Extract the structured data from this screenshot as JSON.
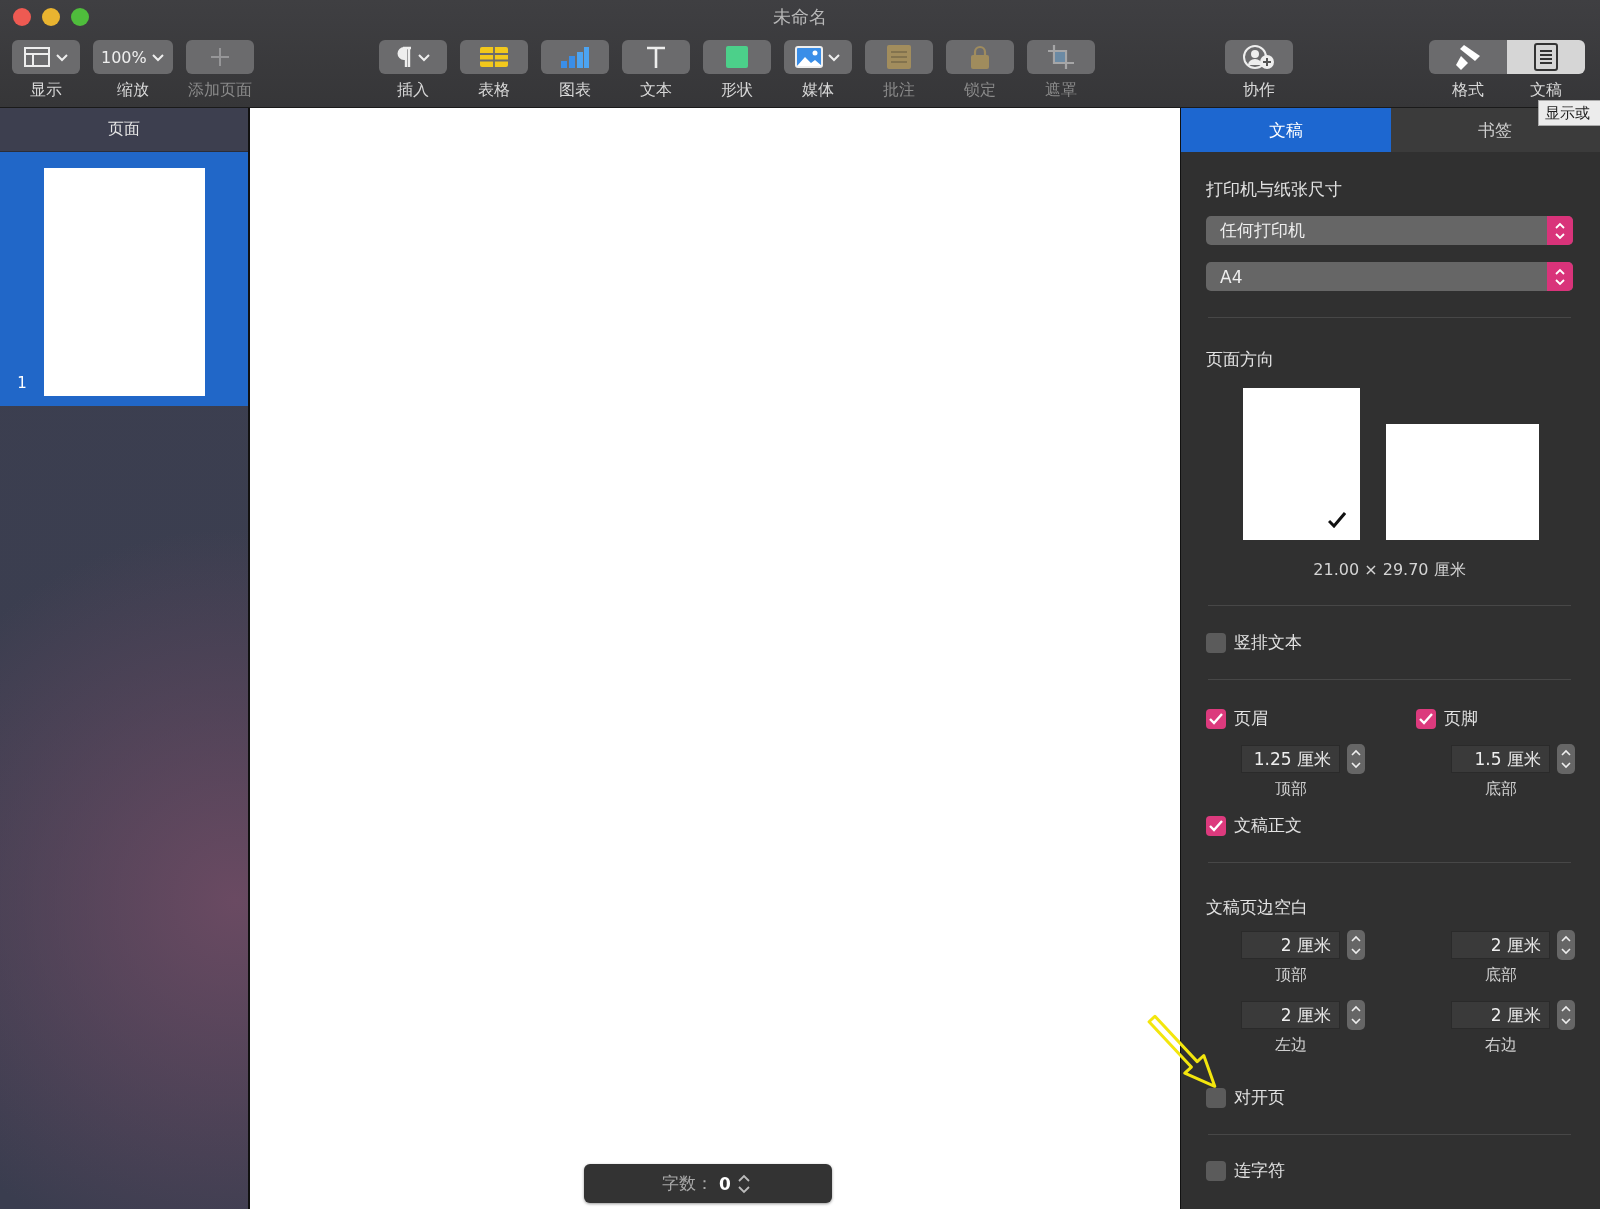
{
  "window": {
    "title": "未命名"
  },
  "toolbar": {
    "groups": [
      [
        {
          "kind": "view",
          "label": "显示",
          "disabled": false
        },
        {
          "kind": "zoom",
          "label": "缩放",
          "value": "100%",
          "disabled": false
        },
        {
          "kind": "add_page",
          "label": "添加页面",
          "disabled": true
        }
      ],
      [
        {
          "kind": "insert",
          "label": "插入",
          "disabled": false
        },
        {
          "kind": "table",
          "label": "表格",
          "disabled": false
        },
        {
          "kind": "chart",
          "label": "图表",
          "disabled": false
        },
        {
          "kind": "text",
          "label": "文本",
          "disabled": false
        },
        {
          "kind": "shape",
          "label": "形状",
          "disabled": false
        },
        {
          "kind": "media",
          "label": "媒体",
          "disabled": false
        },
        {
          "kind": "comment",
          "label": "批注",
          "disabled": true
        },
        {
          "kind": "lock",
          "label": "锁定",
          "disabled": true
        },
        {
          "kind": "mask",
          "label": "遮罩",
          "disabled": true
        }
      ],
      [
        {
          "kind": "collaborate",
          "label": "协作",
          "disabled": false
        }
      ]
    ],
    "inspector_switch": [
      {
        "kind": "format",
        "label": "格式",
        "selected": false
      },
      {
        "kind": "document",
        "label": "文稿",
        "selected": true
      }
    ],
    "tooltip": "显示或"
  },
  "sidebar": {
    "title": "页面",
    "pages": [
      {
        "number": "1",
        "selected": true
      }
    ]
  },
  "word_count": {
    "label": "字数：",
    "value": "0"
  },
  "inspector": {
    "tabs": [
      {
        "label": "文稿",
        "selected": true
      },
      {
        "label": "书签",
        "selected": false
      }
    ],
    "printer": {
      "heading": "打印机与纸张尺寸",
      "printer": "任何打印机",
      "paper_size": "A4"
    },
    "orientation": {
      "heading": "页面方向",
      "options": [
        {
          "kind": "portrait",
          "selected": true
        },
        {
          "kind": "landscape",
          "selected": false
        }
      ],
      "dimensions": "21.00 × 29.70 厘米"
    },
    "vertical_text": {
      "label": "竖排文本",
      "checked": false
    },
    "header_footer": [
      {
        "label": "页眉",
        "checked": true,
        "value": "1.25 厘米",
        "caption": "顶部"
      },
      {
        "label": "页脚",
        "checked": true,
        "value": "1.5 厘米",
        "caption": "底部"
      }
    ],
    "body": {
      "label": "文稿正文",
      "checked": true
    },
    "margins": {
      "heading": "文稿页边空白",
      "fields": [
        {
          "value": "2 厘米",
          "caption": "顶部"
        },
        {
          "value": "2 厘米",
          "caption": "底部"
        },
        {
          "value": "2 厘米",
          "caption": "左边"
        },
        {
          "value": "2 厘米",
          "caption": "右边"
        }
      ]
    },
    "facing_pages": {
      "label": "对开页",
      "checked": false
    },
    "hyphenation": {
      "label": "连字符",
      "checked": false
    }
  }
}
